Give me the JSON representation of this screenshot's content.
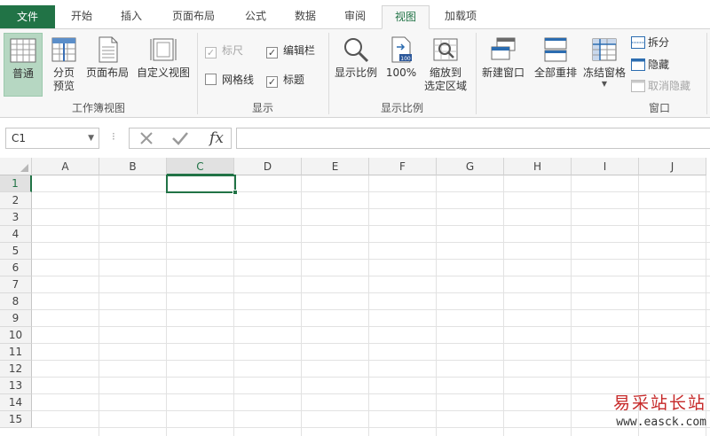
{
  "tabs": [
    {
      "label": "文件"
    },
    {
      "label": "开始"
    },
    {
      "label": "插入"
    },
    {
      "label": "页面布局"
    },
    {
      "label": "公式"
    },
    {
      "label": "数据"
    },
    {
      "label": "审阅"
    },
    {
      "label": "视图"
    },
    {
      "label": "加载项"
    }
  ],
  "active_tab": "视图",
  "ribbon": {
    "workbook_views": {
      "group_label": "工作簿视图",
      "normal": "普通",
      "page_break_1": "分页",
      "page_break_2": "预览",
      "page_layout": "页面布局",
      "custom_views": "自定义视图"
    },
    "show": {
      "group_label": "显示",
      "ruler": "标尺",
      "formula_bar": "编辑栏",
      "gridlines": "网格线",
      "headings": "标题"
    },
    "zoom": {
      "group_label": "显示比例",
      "zoom": "显示比例",
      "hundred": "100%",
      "zoom_sel_1": "缩放到",
      "zoom_sel_2": "选定区域"
    },
    "window": {
      "group_label": "窗口",
      "new_window": "新建窗口",
      "arrange_all": "全部重排",
      "freeze_panes": "冻结窗格",
      "split": "拆分",
      "hide": "隐藏",
      "unhide": "取消隐藏"
    }
  },
  "formula_bar": {
    "name_box": "C1",
    "fx": "fx",
    "value": ""
  },
  "grid": {
    "columns": [
      "A",
      "B",
      "C",
      "D",
      "E",
      "F",
      "G",
      "H",
      "I",
      "J"
    ],
    "rows": [
      "1",
      "2",
      "3",
      "4",
      "5",
      "6",
      "7",
      "8",
      "9",
      "10",
      "11",
      "12",
      "13",
      "14",
      "15"
    ],
    "selected_column": "C",
    "selected_row": "1"
  },
  "watermark": {
    "line1": "易采站长站",
    "line2": "www.easck.com"
  },
  "colors": {
    "accent": "#217346",
    "selected_button": "#b6d7c2",
    "watermark_red": "#c62828"
  }
}
